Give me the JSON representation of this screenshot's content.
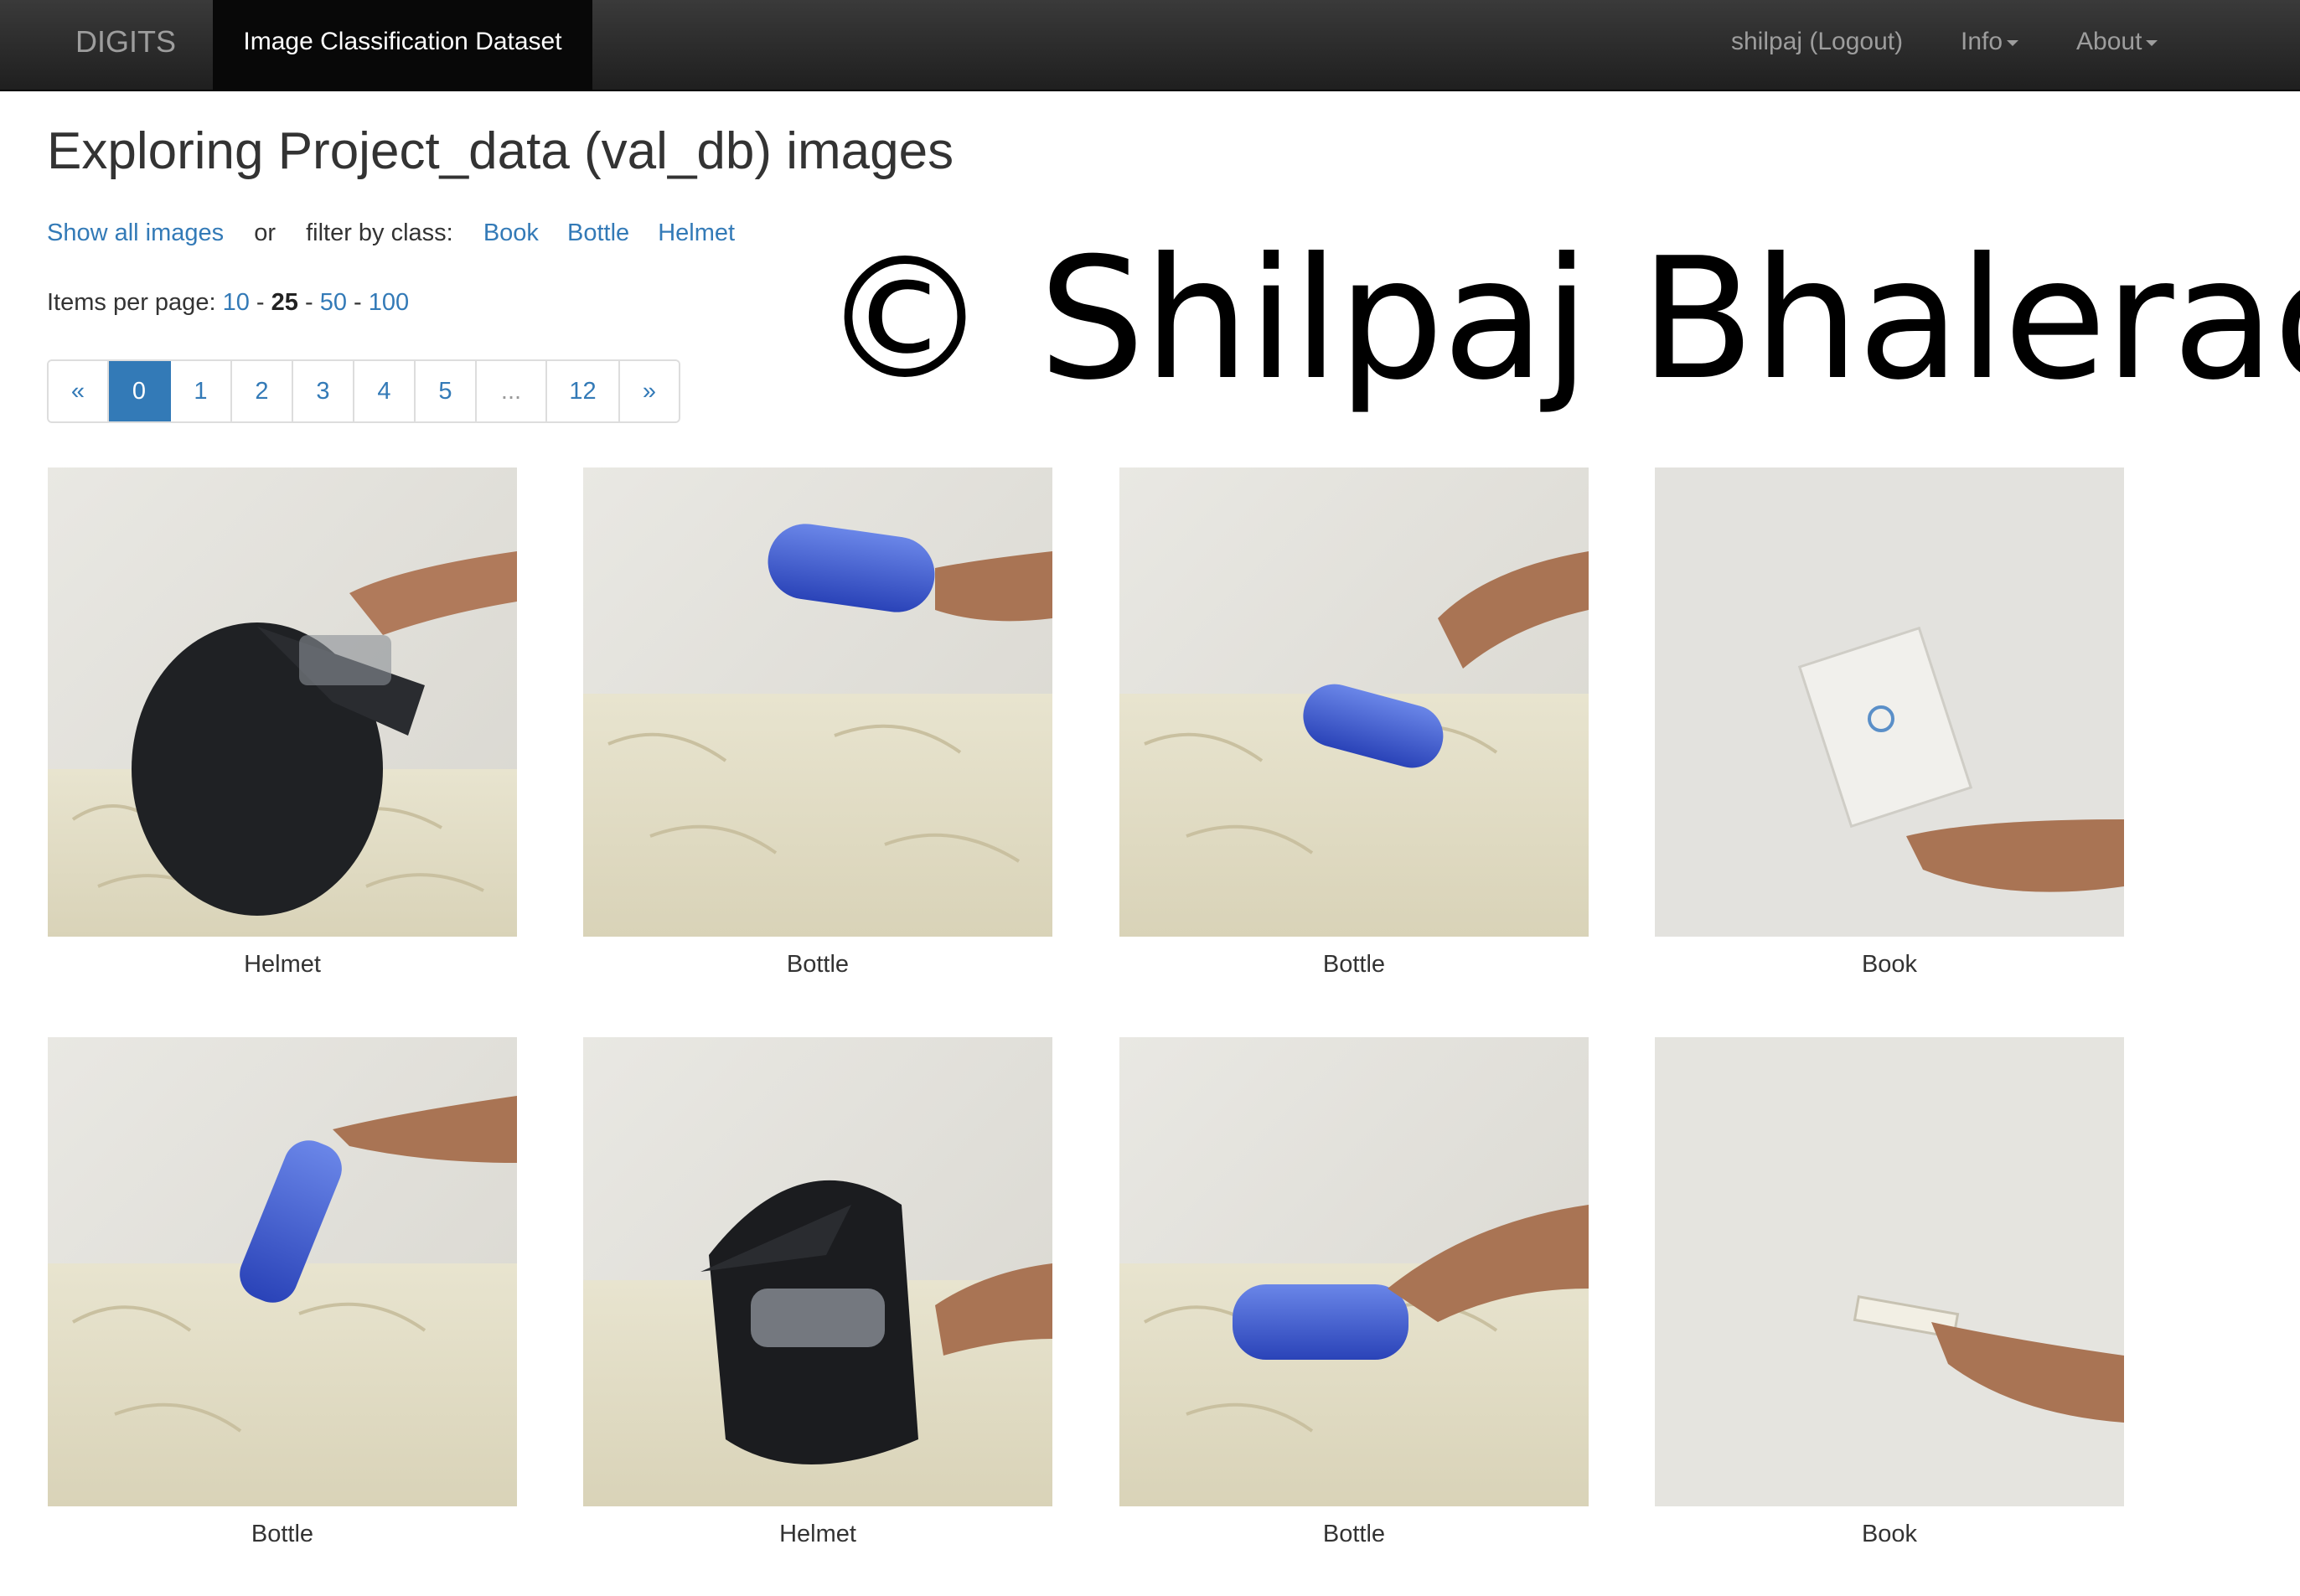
{
  "navbar": {
    "brand": "DIGITS",
    "active_tab": "Image Classification Dataset",
    "user": "shilpaj (Logout)",
    "info": "Info",
    "about": "About"
  },
  "page": {
    "title": "Exploring Project_data (val_db) images",
    "show_all": "Show all images",
    "or": "or",
    "filter_label": "filter by class:",
    "classes": [
      "Book",
      "Bottle",
      "Helmet"
    ],
    "ipp_label": "Items per page:",
    "ipp": [
      "10",
      "25",
      "50",
      "100"
    ],
    "ipp_sep": "-",
    "ipp_current": "25"
  },
  "pagination": {
    "prev": "«",
    "pages": [
      "0",
      "1",
      "2",
      "3",
      "4",
      "5",
      "...",
      "12"
    ],
    "next": "»",
    "current": "0"
  },
  "watermark": "© Shilpaj Bhalerao",
  "images": [
    {
      "label": "Helmet",
      "subject": "helmet-side"
    },
    {
      "label": "Bottle",
      "subject": "bottle-held-high"
    },
    {
      "label": "Bottle",
      "subject": "bottle-falling"
    },
    {
      "label": "Book",
      "subject": "book-held"
    },
    {
      "label": "Bottle",
      "subject": "bottle-upright"
    },
    {
      "label": "Helmet",
      "subject": "helmet-front"
    },
    {
      "label": "Bottle",
      "subject": "bottle-lying"
    },
    {
      "label": "Book",
      "subject": "book-thin"
    }
  ]
}
